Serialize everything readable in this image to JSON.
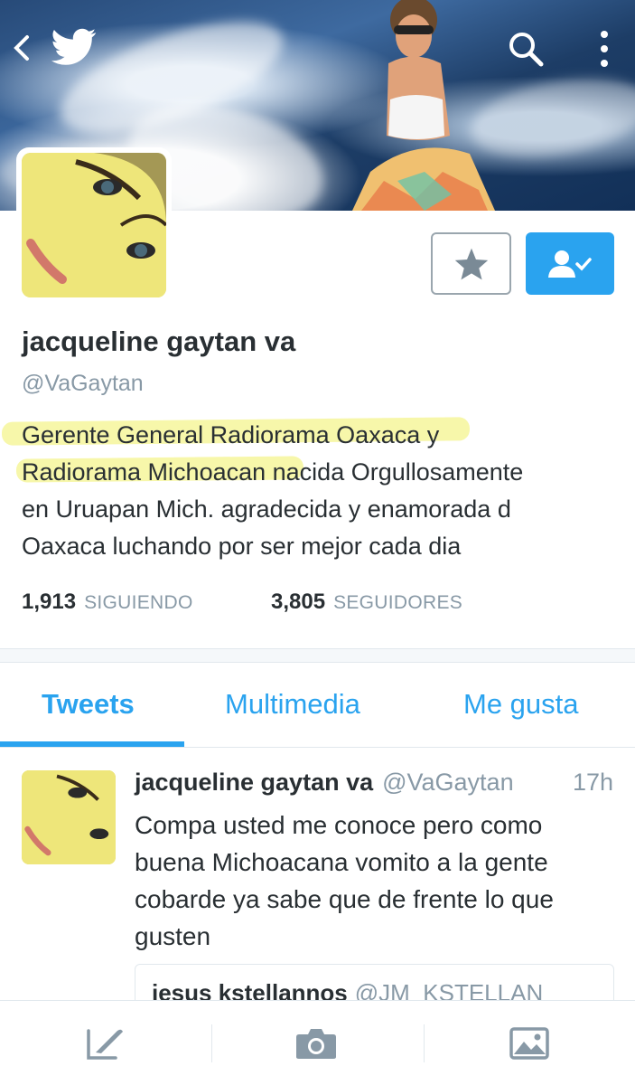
{
  "profile": {
    "name": "jacqueline gaytan va",
    "handle": "@VaGaytan",
    "bio_line1_hl": "Gerente General Radiorama Oaxaca",
    "bio_line1_rest": " y",
    "bio_line2_hl": "Radiorama Michoacan",
    "bio_line2_rest": " nacida Orgullosamente",
    "bio_line3": "en Uruapan Mich. agradecida y enamorada d",
    "bio_line4": "Oaxaca luchando por ser mejor cada dia"
  },
  "stats": {
    "following_count": "1,913",
    "following_label": "SIGUIENDO",
    "followers_count": "3,805",
    "followers_label": "SEGUIDORES"
  },
  "tabs": [
    {
      "label": "Tweets"
    },
    {
      "label": "Multimedia"
    },
    {
      "label": "Me gusta"
    }
  ],
  "tweet": {
    "name": "jacqueline gaytan va",
    "handle": "@VaGaytan",
    "time": "17h",
    "text": "Compa usted me conoce pero como buena Michoacana vomito a la gente cobarde ya sabe que de frente lo que gusten",
    "quote_name": "jesus kstellannos",
    "quote_handle": "@JM_KSTELLAN"
  },
  "colors": {
    "accent": "#2aa3ef",
    "muted": "#8899a6",
    "text": "#292f33",
    "highlight": "#f0f064"
  },
  "icons": {
    "back": "chevron-left-icon",
    "logo": "twitter-bird-icon",
    "search": "search-icon",
    "more": "more-vertical-icon",
    "star": "star-icon",
    "following": "user-check-icon",
    "compose": "compose-icon",
    "camera": "camera-icon",
    "image": "image-icon"
  }
}
